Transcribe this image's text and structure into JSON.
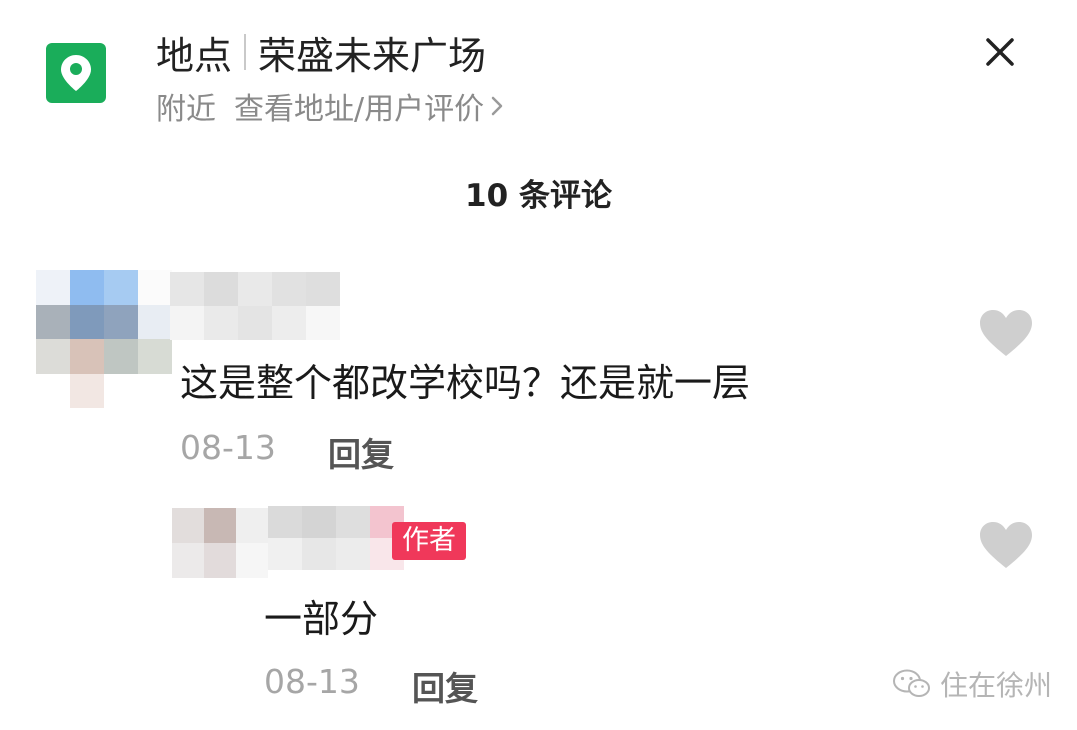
{
  "header": {
    "label": "地点",
    "place_name": "荣盛未来广场",
    "nearby": "附近",
    "view_link": "查看地址/用户评价"
  },
  "comments_header": {
    "title": "10 条评论"
  },
  "comments": [
    {
      "text": "这是整个都改学校吗？还是就一层",
      "date": "08-13",
      "reply_label": "回复"
    },
    {
      "badge": "作者",
      "text": "一部分",
      "date": "08-13",
      "reply_label": "回复"
    }
  ],
  "watermark": {
    "text": "住在徐州"
  },
  "colors": {
    "location_icon_bg": "#1aad5a",
    "author_badge": "#f0385a",
    "heart": "#cfcfcf",
    "muted_text": "#a6a6a6"
  },
  "icons": {
    "location": "location-pin-icon",
    "close": "close-icon",
    "chevron": "chevron-right-icon",
    "like": "heart-icon",
    "watermark": "wechat-icon"
  }
}
